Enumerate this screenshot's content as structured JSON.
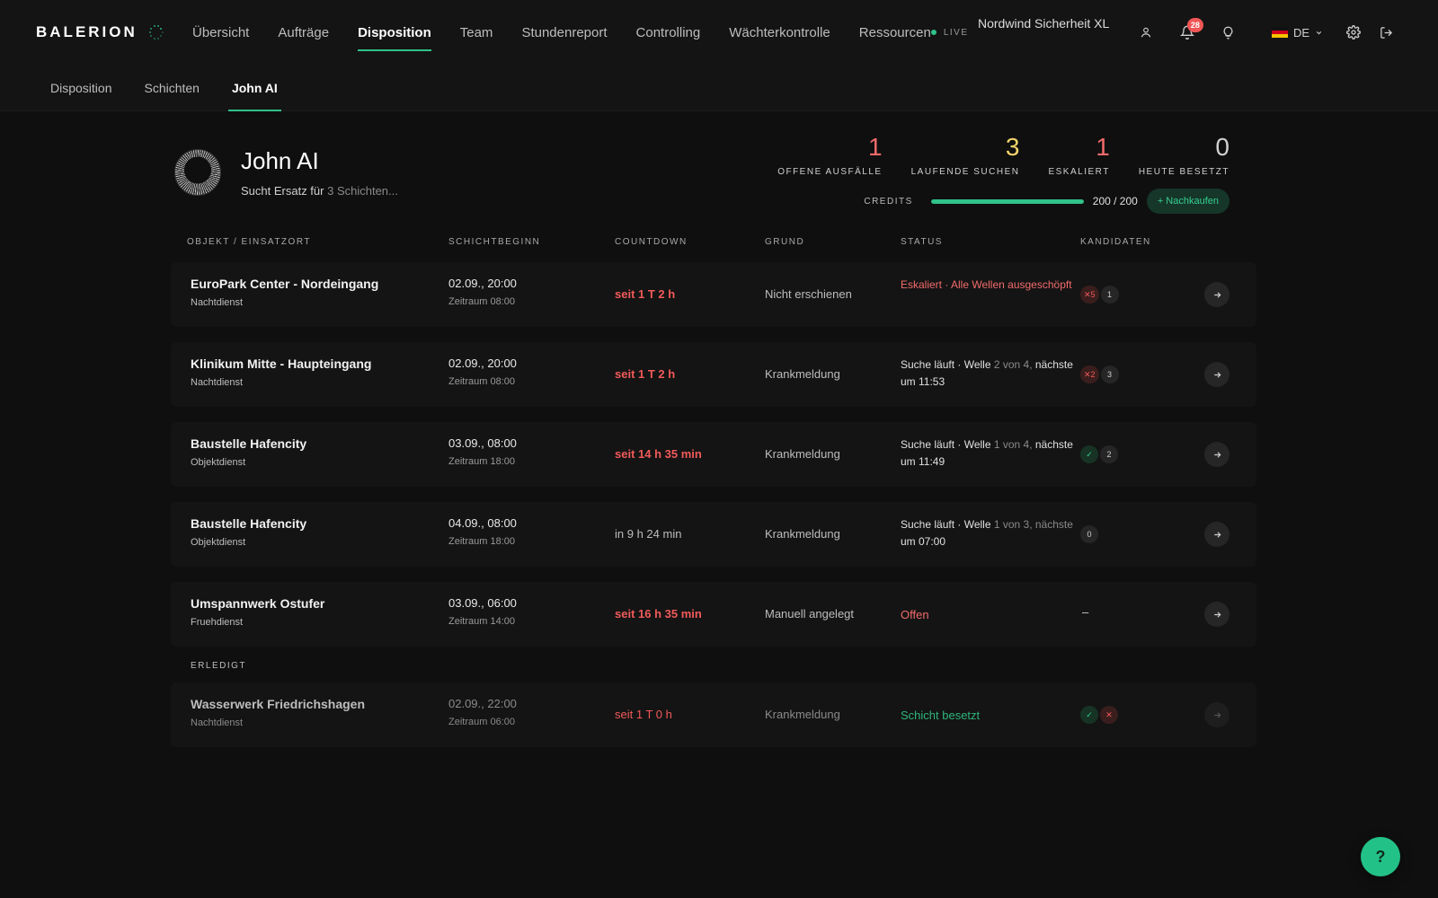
{
  "brand": {
    "name": "BALERION",
    "accent": "#2fc28a"
  },
  "nav": {
    "items": [
      {
        "label": "Übersicht",
        "active": false
      },
      {
        "label": "Aufträge",
        "active": false
      },
      {
        "label": "Disposition",
        "active": true
      },
      {
        "label": "Team",
        "active": false
      },
      {
        "label": "Stundenreport",
        "active": false
      },
      {
        "label": "Controlling",
        "active": false
      },
      {
        "label": "Wächterkontrolle",
        "active": false
      },
      {
        "label": "Ressourcen",
        "active": false
      }
    ],
    "live_label": "LIVE",
    "company": "Nordwind Sicherheit XL",
    "notifications_count": "28",
    "language": "DE"
  },
  "subnav": {
    "items": [
      {
        "label": "Disposition",
        "active": false
      },
      {
        "label": "Schichten",
        "active": false
      },
      {
        "label": "John AI",
        "active": true
      }
    ]
  },
  "agent": {
    "name": "John AI",
    "subtitle_prefix": "Sucht Ersatz für",
    "subtitle_muted": "3 Schichten..."
  },
  "stats": [
    {
      "value": "1",
      "label": "OFFENE AUSFÄLLE",
      "color": "red"
    },
    {
      "value": "3",
      "label": "LAUFENDE SUCHEN",
      "color": "yellow"
    },
    {
      "value": "1",
      "label": "ESKALIERT",
      "color": "red"
    },
    {
      "value": "0",
      "label": "HEUTE BESETZT",
      "color": "grey"
    }
  ],
  "credits": {
    "label": "CREDITS",
    "used": 200,
    "total": 200,
    "value_text": "200 / 200",
    "buy_label": "+ Nachkaufen"
  },
  "table": {
    "headers": {
      "object": "OBJEKT / EINSATZORT",
      "start": "SCHICHTBEGINN",
      "countdown": "COUNTDOWN",
      "reason": "GRUND",
      "status": "STATUS",
      "candidates": "KANDIDATEN"
    },
    "rows": [
      {
        "title": "EuroPark Center - Nordeingang",
        "subtitle": "Nachtdienst",
        "start": "02.09., 20:00",
        "period": "Zeitraum 08:00",
        "countdown": "seit 1 T 2 h",
        "countdown_type": "late",
        "reason": "Nicht erschienen",
        "status_type": "escalated",
        "status_parts": [
          {
            "text": "Eskaliert · Alle Wellen ausgeschöpft",
            "muted": false
          }
        ],
        "candidates": [
          {
            "text": "✕5",
            "kind": "red"
          },
          {
            "text": "1",
            "kind": "neutral"
          }
        ]
      },
      {
        "title": "Klinikum Mitte - Haupteingang",
        "subtitle": "Nachtdienst",
        "start": "02.09., 20:00",
        "period": "Zeitraum 08:00",
        "countdown": "seit 1 T 2 h",
        "countdown_type": "late",
        "reason": "Krankmeldung",
        "status_type": "running",
        "status_parts": [
          {
            "text": "Suche läuft · Welle ",
            "muted": false
          },
          {
            "text": "2 von 4,",
            "muted": true
          },
          {
            "text": " nächste um 11:53",
            "muted": false
          }
        ],
        "candidates": [
          {
            "text": "✕2",
            "kind": "red"
          },
          {
            "text": "3",
            "kind": "neutral"
          }
        ]
      },
      {
        "title": "Baustelle Hafencity",
        "subtitle": "Objektdienst",
        "start": "03.09., 08:00",
        "period": "Zeitraum 18:00",
        "countdown": "seit 14 h 35 min",
        "countdown_type": "late",
        "reason": "Krankmeldung",
        "status_type": "running",
        "status_parts": [
          {
            "text": "Suche läuft · Welle ",
            "muted": false
          },
          {
            "text": "1 von 4,",
            "muted": true
          },
          {
            "text": " nächste um 11:49",
            "muted": false
          }
        ],
        "candidates": [
          {
            "text": "✓",
            "kind": "green"
          },
          {
            "text": "2",
            "kind": "neutral"
          }
        ]
      },
      {
        "title": "Baustelle Hafencity",
        "subtitle": "Objektdienst",
        "start": "04.09., 08:00",
        "period": "Zeitraum 18:00",
        "countdown": "in 9 h 24 min",
        "countdown_type": "future",
        "reason": "Krankmeldung",
        "status_type": "running",
        "status_parts": [
          {
            "text": "Suche läuft · Welle ",
            "muted": false
          },
          {
            "text": "1 von 3, nächste",
            "muted": true
          },
          {
            "text": " um 07:00",
            "muted": false
          }
        ],
        "candidates": [
          {
            "text": "0",
            "kind": "neutral"
          }
        ]
      },
      {
        "title": "Umspannwerk Ostufer",
        "subtitle": "Fruehdienst",
        "start": "03.09., 06:00",
        "period": "Zeitraum 14:00",
        "countdown": "seit 16 h 35 min",
        "countdown_type": "late",
        "reason": "Manuell angelegt",
        "status_type": "open",
        "status_parts": [
          {
            "text": "Offen",
            "muted": false
          }
        ],
        "candidates_text": "–",
        "candidates": []
      }
    ],
    "done_label": "ERLEDIGT",
    "done_rows": [
      {
        "title": "Wasserwerk Friedrichshagen",
        "subtitle": "Nachtdienst",
        "start": "02.09., 22:00",
        "period": "Zeitraum 06:00",
        "countdown": "seit 1 T 0 h",
        "countdown_type": "late",
        "reason": "Krankmeldung",
        "status_type": "done",
        "status_parts": [
          {
            "text": "Schicht besetzt",
            "muted": false
          }
        ],
        "candidates": [
          {
            "text": "✓",
            "kind": "green"
          },
          {
            "text": "✕",
            "kind": "red"
          }
        ]
      }
    ]
  },
  "help_label": "?",
  "icons": {
    "user": "user-icon",
    "bell": "bell-icon",
    "bulb": "lightbulb-icon",
    "settings": "gear-icon",
    "logout": "logout-icon",
    "arrow": "arrow-right-icon",
    "chevron": "chevron-down-icon"
  }
}
